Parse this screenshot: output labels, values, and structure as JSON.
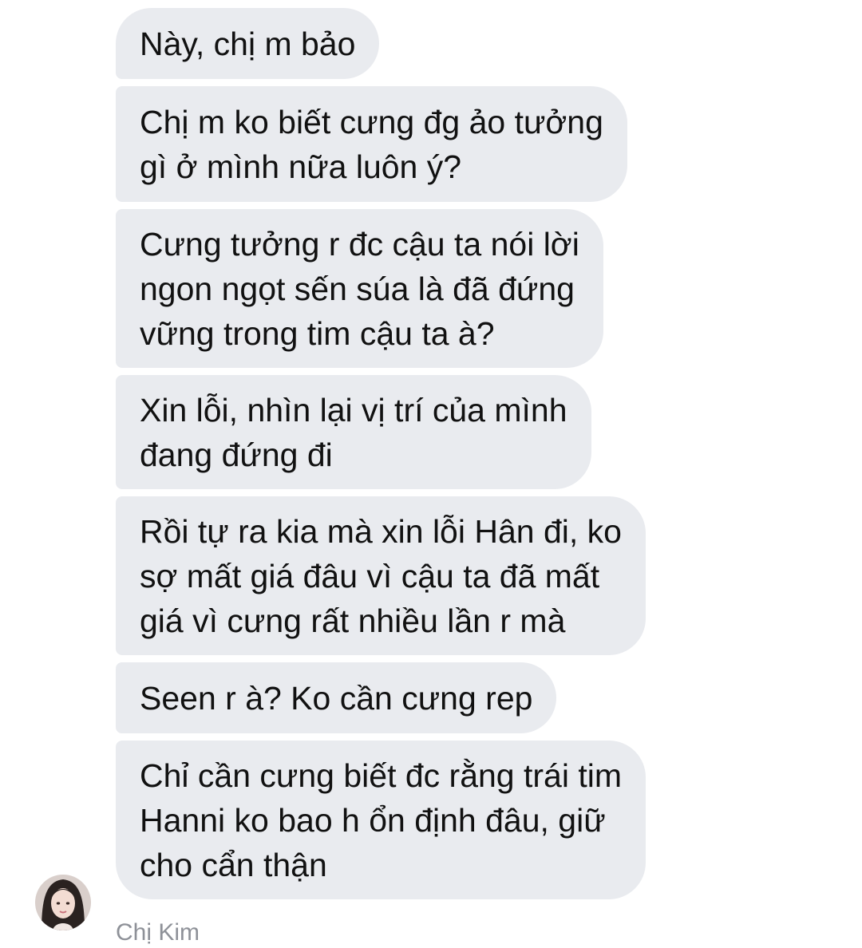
{
  "conversation": {
    "messages": [
      "Này, chị m bảo",
      "Chị m ko biết cưng đg ảo tưởng\ngì ở mình nữa luôn ý?",
      "Cưng tưởng r đc cậu ta nói lời\nngon ngọt sến súa là đã đứng\nvững trong tim cậu ta à?",
      "Xin lỗi, nhìn lại vị trí của mình\nđang đứng đi",
      "Rồi tự ra kia mà xin lỗi Hân đi, ko\nsợ mất giá đâu vì cậu ta đã mất\ngiá vì cưng rất nhiều lần r mà",
      "Seen r à? Ko cần cưng rep",
      "Chỉ cần cưng biết đc rằng trái tim\nHanni ko bao h ổn định đâu, giữ\ncho cẩn thận"
    ],
    "sender": {
      "name": "Chị Kim",
      "avatar_icon": "profile-photo"
    },
    "colors": {
      "bubble": "#e9ebef",
      "text": "#111111",
      "sender_name": "#8e9198"
    }
  }
}
